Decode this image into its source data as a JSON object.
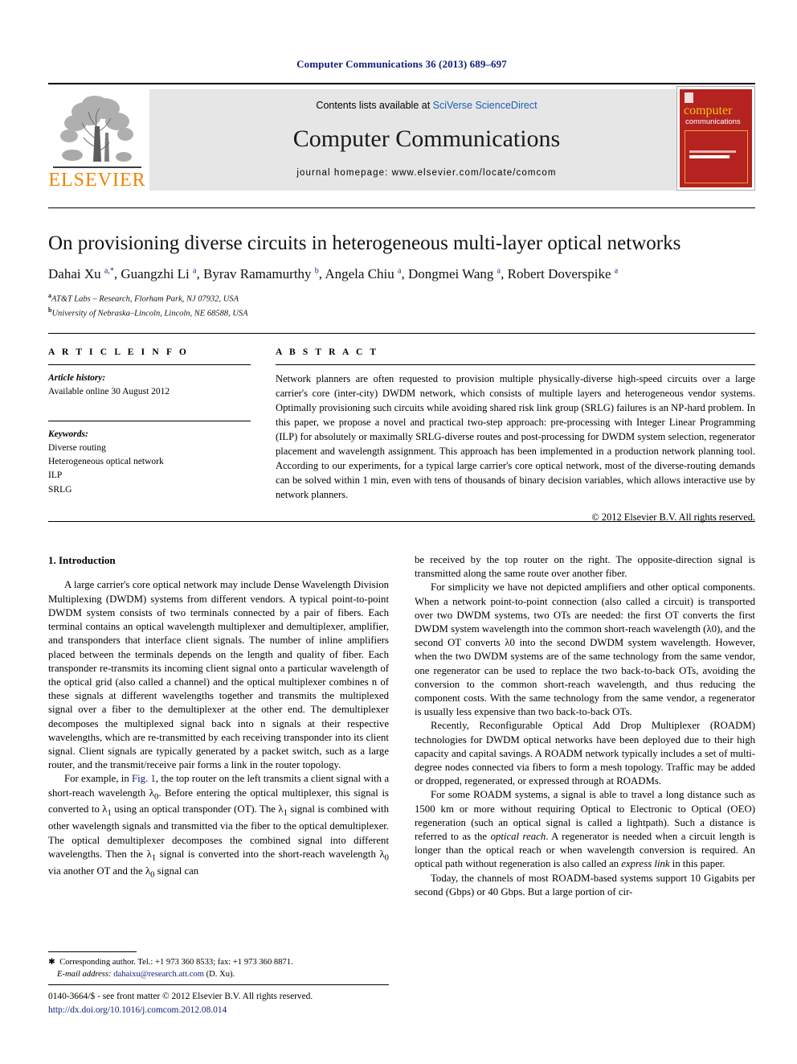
{
  "running_head": "Computer Communications 36 (2013) 689–697",
  "masthead": {
    "contents_prefix": "Contents lists available at ",
    "contents_link": "SciVerse ScienceDirect",
    "journal_name": "Computer Communications",
    "homepage": "journal homepage: www.elsevier.com/locate/comcom",
    "publisher_logo_text": "ELSEVIER",
    "cover": {
      "title_line1": "computer",
      "title_line2": "communications"
    },
    "accent_orange": "#ef8200",
    "link_blue": "#1a5fb4",
    "cover_red": "#b4231f"
  },
  "article": {
    "title": "On provisioning diverse circuits in heterogeneous multi-layer optical networks",
    "authors_html": "Dahai Xu <sup>a,*</sup>, Guangzhi Li <sup>a</sup>, Byrav Ramamurthy <sup>b</sup>, Angela Chiu <sup>a</sup>, Dongmei Wang <sup>a</sup>, Robert Doverspike <sup>a</sup>",
    "affiliations": [
      {
        "marker": "a",
        "text": "AT&T Labs – Research, Florham Park, NJ 07932, USA"
      },
      {
        "marker": "b",
        "text": "University of Nebraska–Lincoln, Lincoln, NE 68588, USA"
      }
    ]
  },
  "article_info": {
    "heading": "A R T I C L E    I N F O",
    "history_label": "Article history:",
    "history_value": "Available online 30 August 2012",
    "keywords_label": "Keywords:",
    "keywords": [
      "Diverse routing",
      "Heterogeneous optical network",
      "ILP",
      "SRLG"
    ]
  },
  "abstract": {
    "heading": "A B S T R A C T",
    "text": "Network planners are often requested to provision multiple physically-diverse high-speed circuits over a large carrier's core (inter-city) DWDM network, which consists of multiple layers and heterogeneous vendor systems. Optimally provisioning such circuits while avoiding shared risk link group (SRLG) failures is an NP-hard problem. In this paper, we propose a novel and practical two-step approach: pre-processing with Integer Linear Programming (ILP) for absolutely or maximally SRLG-diverse routes and post-processing for DWDM system selection, regenerator placement and wavelength assignment. This approach has been implemented in a production network planning tool. According to our experiments, for a typical large carrier's core optical network, most of the diverse-routing demands can be solved within 1 min, even with tens of thousands of binary decision variables, which allows interactive use by network planners.",
    "copyright": "© 2012 Elsevier B.V. All rights reserved."
  },
  "body": {
    "section_heading": "1. Introduction",
    "left_paragraphs": [
      "A large carrier's core optical network may include Dense Wavelength Division Multiplexing (DWDM) systems from different vendors. A typical point-to-point DWDM system consists of two terminals connected by a pair of fibers. Each terminal contains an optical wavelength multiplexer and demultiplexer, amplifier, and transponders that interface client signals. The number of inline amplifiers placed between the terminals depends on the length and quality of fiber. Each transponder re-transmits its incoming client signal onto a particular wavelength of the optical grid (also called a channel) and the optical multiplexer combines n of these signals at different wavelengths together and transmits the multiplexed signal over a fiber to the demultiplexer at the other end. The demultiplexer decomposes the multiplexed signal back into n signals at their respective wavelengths, which are re-transmitted by each receiving transponder into its client signal. Client signals are typically generated by a packet switch, such as a large router, and the transmit/receive pair forms a link in the router topology."
    ],
    "left_par2_a": "For example, in ",
    "left_par2_link": "Fig. 1",
    "left_par2_b": ", the top router on the left transmits a client signal with a short-reach wavelength λ",
    "left_par2_c": ". Before entering the optical multiplexer, this signal is converted to λ",
    "left_par2_d": " using an optical transponder (OT). The λ",
    "left_par2_e": " signal is combined with other wavelength signals and transmitted via the fiber to the optical demultiplexer. The optical demultiplexer decomposes the combined signal into different wavelengths. Then the λ",
    "left_par2_f": " signal is converted into the short-reach wavelength λ",
    "left_par2_g": " via another OT and the λ",
    "left_par2_h": " signal can",
    "right_paragraphs": [
      "be received by the top router on the right. The opposite-direction signal is transmitted along the same route over another fiber.",
      "For simplicity we have not depicted amplifiers and other optical components. When a network point-to-point connection (also called a circuit) is transported over two DWDM systems, two OTs are needed: the first OT converts the first DWDM system wavelength into the common short-reach wavelength (λ0), and the second OT converts λ0 into the second DWDM system wavelength. However, when the two DWDM systems are of the same technology from the same vendor, one regenerator can be used to replace the two back-to-back OTs, avoiding the conversion to the common short-reach wavelength, and thus reducing the component costs. With the same technology from the same vendor, a regenerator is usually less expensive than two back-to-back OTs.",
      "Recently, Reconfigurable Optical Add Drop Multiplexer (ROADM) technologies for DWDM optical networks have been deployed due to their high capacity and capital savings. A ROADM network typically includes a set of multi-degree nodes connected via fibers to form a mesh topology. Traffic may be added or dropped, regenerated, or expressed through at ROADMs."
    ],
    "right_par4_a": "For some ROADM systems, a signal is able to travel a long distance such as 1500 km or more without requiring Optical to Electronic to Optical (OEO) regeneration (such an optical signal is called a lightpath). Such a distance is referred to as the ",
    "right_par4_it1": "optical reach",
    "right_par4_b": ". A regenerator is needed when a circuit length is longer than the optical reach or when wavelength conversion is required. An optical path without regeneration is also called an ",
    "right_par4_it2": "express link",
    "right_par4_c": " in this paper.",
    "right_par5": "Today, the channels of most ROADM-based systems support 10 Gigabits per second (Gbps) or 40 Gbps. But a large portion of cir-"
  },
  "footnotes": {
    "corresponding": "Corresponding author. Tel.: +1 973 360 8533; fax: +1 973 360 8871.",
    "email_label": "E-mail address:",
    "email": "dahaixu@research.att.com",
    "email_suffix": "(D. Xu)."
  },
  "imprint": {
    "issn_line": "0140-3664/$ - see front matter © 2012 Elsevier B.V. All rights reserved.",
    "doi": "http://dx.doi.org/10.1016/j.comcom.2012.08.014"
  }
}
